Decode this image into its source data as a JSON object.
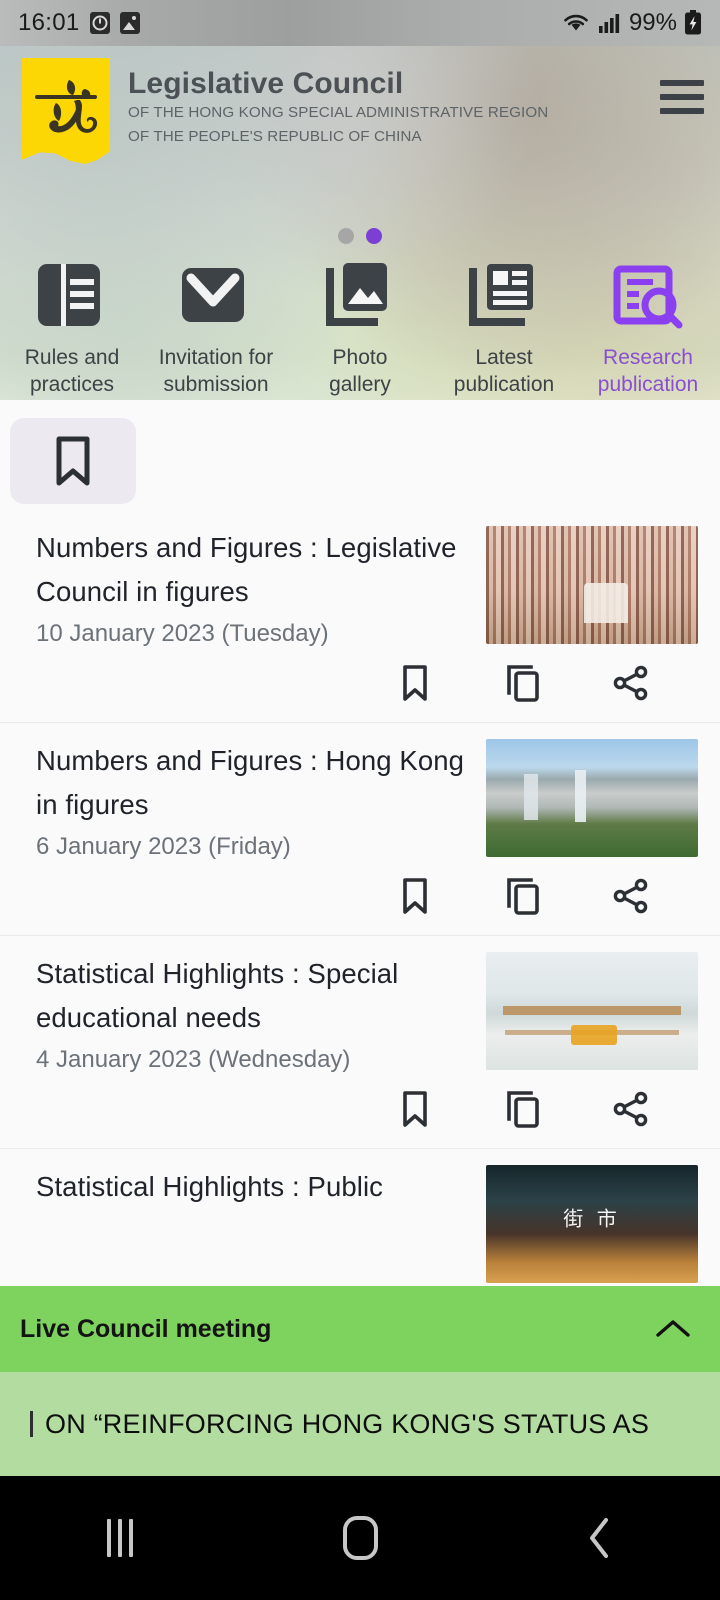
{
  "status_bar": {
    "time": "16:01",
    "icons": [
      "clock-icon",
      "gallery-icon"
    ],
    "wifi_icon": "wifi-icon",
    "signal_icon": "cellular-signal-icon",
    "battery_percent": "99%",
    "battery_icon": "battery-charging-icon"
  },
  "header": {
    "title": "Legislative Council",
    "subtitle_line1": "OF THE HONG KONG SPECIAL ADMINISTRATIVE REGION",
    "subtitle_line2": "OF THE PEOPLE'S REPUBLIC OF CHINA",
    "logo_name": "legco-logo",
    "menu_icon": "hamburger-menu-icon"
  },
  "pager": {
    "dots": [
      {
        "active": false,
        "color": "#a6a6a6"
      },
      {
        "active": true,
        "color": "#7b3fd4"
      }
    ]
  },
  "icon_nav": {
    "active_color": "#8a4fd0",
    "underline_color": "#7c4aa8",
    "items": [
      {
        "icon": "rules-book-icon",
        "label_line1": "Rules and",
        "label_line2": "practices",
        "active": false
      },
      {
        "icon": "envelope-icon",
        "label_line1": "Invitation for",
        "label_line2": "submission",
        "active": false
      },
      {
        "icon": "photo-gallery-icon",
        "label_line1": "Photo",
        "label_line2": "gallery",
        "active": false
      },
      {
        "icon": "newspaper-icon",
        "label_line1": "Latest",
        "label_line2": "publication",
        "active": false
      },
      {
        "icon": "research-document-search-icon",
        "label_line1": "Research",
        "label_line2": "publication",
        "active": true
      }
    ]
  },
  "list": {
    "filter_icon": "bookmark-filter-icon",
    "action_labels": {
      "bookmark": "bookmark-icon",
      "copy": "copy-icon",
      "share": "share-icon"
    },
    "items": [
      {
        "title": "Numbers and Figures : Legislative Council in figures",
        "date": "10 January 2023 (Tuesday)",
        "thumb": "chamber"
      },
      {
        "title": "Numbers and Figures : Hong Kong in figures",
        "date": "6 January 2023 (Friday)",
        "thumb": "harbour"
      },
      {
        "title": "Statistical Highlights : Special educational needs",
        "date": "4 January 2023 (Wednesday)",
        "thumb": "classroom"
      },
      {
        "title": "Statistical Highlights : Public",
        "date": "",
        "thumb": "market"
      }
    ]
  },
  "live_banner": {
    "title": "Live Council meeting",
    "collapse_icon": "chevron-up-icon",
    "header_color": "#7ed35e",
    "marquee_color": "#b3dda0",
    "marquee_text": "ON “REINFORCING HONG KONG'S STATUS AS"
  },
  "android_nav": {
    "recents_icon": "recents-icon",
    "home_icon": "home-icon",
    "back_icon": "back-icon"
  }
}
